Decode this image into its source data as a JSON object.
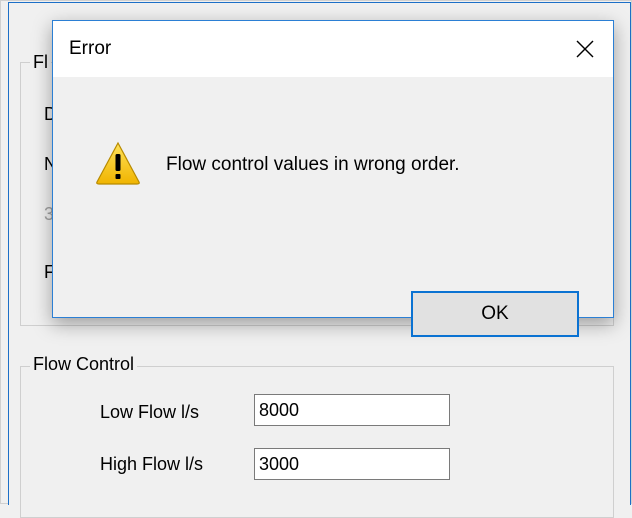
{
  "background": {
    "top_group_partial_title": "Fl",
    "partial_labels": [
      "D",
      "N",
      "F"
    ],
    "faded_glyph": "3",
    "flow_control": {
      "title": "Flow Control",
      "low_flow_label": "Low Flow l/s",
      "low_flow_value": "8000",
      "high_flow_label": "High Flow l/s",
      "high_flow_value": "3000"
    }
  },
  "dialog": {
    "title": "Error",
    "close_icon": "close-icon",
    "icon": "warning-icon",
    "message": "Flow control values in wrong order.",
    "ok_label": "OK"
  },
  "colors": {
    "accent_border": "#2b7fd4",
    "ok_focus_border": "#0a72d2",
    "warning_fill": "#f2c21b"
  }
}
